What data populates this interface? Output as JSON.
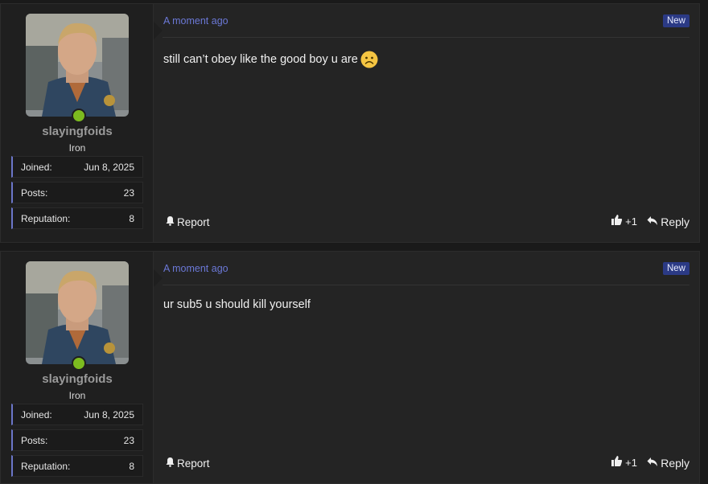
{
  "posts": [
    {
      "user": {
        "name": "slayingfoids",
        "rank": "Iron",
        "stats": [
          {
            "label": "Joined:",
            "value": "Jun 8, 2025"
          },
          {
            "label": "Posts:",
            "value": "23"
          },
          {
            "label": "Reputation:",
            "value": "8"
          }
        ]
      },
      "time": "A moment ago",
      "badge": "New",
      "content": "still can’t obey like the good boy u are",
      "emoji": "slightly-frowning-face-icon",
      "report_label": "Report",
      "likes": "+1",
      "reply_label": "Reply"
    },
    {
      "user": {
        "name": "slayingfoids",
        "rank": "Iron",
        "stats": [
          {
            "label": "Joined:",
            "value": "Jun 8, 2025"
          },
          {
            "label": "Posts:",
            "value": "23"
          },
          {
            "label": "Reputation:",
            "value": "8"
          }
        ]
      },
      "time": "A moment ago",
      "badge": "New",
      "content": "ur sub5 u should kill yourself",
      "report_label": "Report",
      "likes": "+1",
      "reply_label": "Reply"
    }
  ],
  "colors": {
    "accent": "#6b76c9",
    "online": "#7cbb1f",
    "badge_bg": "#2b3a85",
    "timestamp": "#6b78d6"
  }
}
